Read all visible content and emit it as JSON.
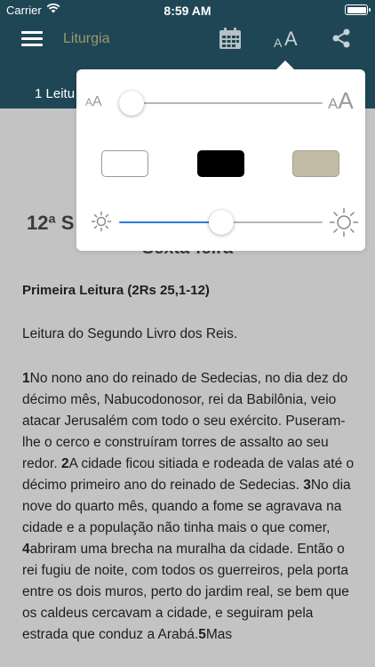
{
  "status_bar": {
    "carrier": "Carrier",
    "time": "8:59 AM",
    "battery_level": 1.0
  },
  "nav": {
    "title": "Liturgia",
    "icons": [
      "menu-icon",
      "calendar-icon",
      "font-size-icon",
      "share-icon"
    ],
    "font_button_small": "A",
    "font_button_big": "A"
  },
  "tabs": {
    "first_tab_label": "1 Leitu"
  },
  "popover": {
    "font_size_small_label": "AA",
    "font_size_big_label": "AA",
    "font_size_level": 0.0,
    "themes": [
      {
        "name": "white",
        "color": "#ffffff"
      },
      {
        "name": "black",
        "color": "#000000"
      },
      {
        "name": "sepia",
        "color": "#c2bba6"
      }
    ],
    "brightness_level": 0.5,
    "accent_color": "#2a7de1"
  },
  "reading": {
    "day_title": "12ª S",
    "weekday": "Sexta-feira",
    "heading": "Primeira Leitura (2Rs 25,1-12)",
    "intro": "Leitura do Segundo Livro dos Reis.",
    "verses": [
      {
        "n": "1",
        "text": "No nono ano do reinado de Sedecias, no dia dez do décimo mês, Nabucodonosor, rei da Babilônia, veio atacar Jerusalém com todo o seu exército. Puseram-lhe o cerco e construíram torres de assalto ao seu redor. "
      },
      {
        "n": "2",
        "text": "A cidade ficou sitiada e rodeada de valas até o décimo primeiro ano do reinado de Sedecias. "
      },
      {
        "n": "3",
        "text": "No dia nove do quarto mês, quando a fome se agravava na cidade e a população não tinha mais o que comer, "
      },
      {
        "n": "4",
        "text": "abriram uma brecha na muralha da cidade. Então o rei fugiu de noite, com todos os guerreiros, pela porta entre os dois muros, perto do jardim real, se bem que os caldeus cercavam a cidade, e seguiram pela estrada que conduz a Arabá."
      },
      {
        "n": "5",
        "text": "Mas"
      }
    ]
  }
}
